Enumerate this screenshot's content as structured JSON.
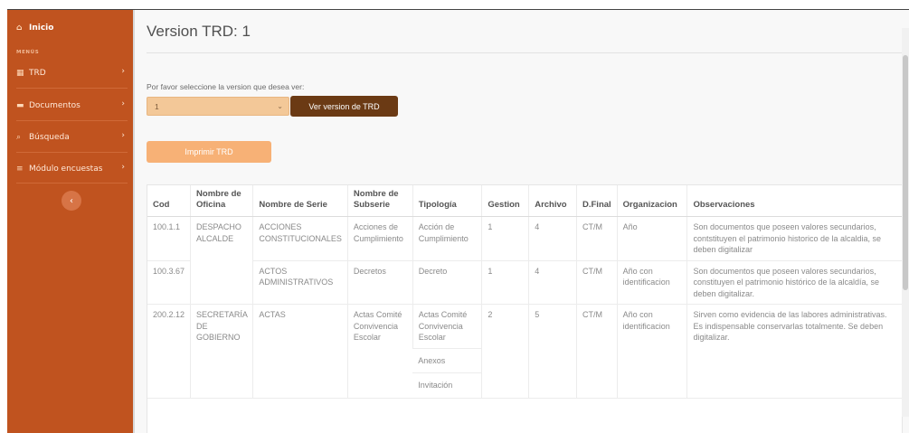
{
  "sidebar": {
    "home_label": "Inicio",
    "section_label": "MENÚS",
    "items": [
      {
        "label": "TRD",
        "icon": "table-icon"
      },
      {
        "label": "Documentos",
        "icon": "folder-icon"
      },
      {
        "label": "Búsqueda",
        "icon": "search-icon"
      },
      {
        "label": "Módulo encuestas",
        "icon": "list-icon"
      }
    ],
    "collapse_icon": "chevron-left-icon"
  },
  "main": {
    "title": "Version TRD: 1",
    "prompt": "Por favor seleccione la version que desea ver:",
    "select_value": "1",
    "ver_button": "Ver version de TRD",
    "print_button": "Imprimir TRD"
  },
  "table": {
    "headers": [
      "Cod",
      "Nombre de Oficina",
      "Nombre de Serie",
      "Nombre de Subserie",
      "Tipología",
      "Gestion",
      "Archivo",
      "D.Final",
      "Organizacion",
      "Observaciones"
    ],
    "rows": [
      {
        "cod": "100.1.1",
        "oficina": "DESPACHO ALCALDE",
        "serie": "ACCIONES CONSTITUCIONALES",
        "subserie": "Acciones de Cumplimiento",
        "tipologia": "Acción de Cumplimiento",
        "gestion": "1",
        "archivo": "4",
        "dfinal": "CT/M",
        "organizacion": "Año",
        "observaciones": "Son documentos que poseen valores secundarios, contstituyen el patrimonio historico de la alcaldia, se deben digitalizar"
      },
      {
        "cod": "100.3.67",
        "oficina": "",
        "serie": "ACTOS ADMINISTRATIVOS",
        "subserie": "Decretos",
        "tipologia": "Decreto",
        "gestion": "1",
        "archivo": "4",
        "dfinal": "CT/M",
        "organizacion": "Año con identificacion",
        "observaciones": "Son documentos que poseen valores secundarios, constituyen el patrimonio histórico de la alcaldía, se deben digitalizar."
      },
      {
        "cod": "200.2.12",
        "oficina": "SECRETARÍA DE GOBIERNO",
        "serie": "ACTAS",
        "subserie": "Actas Comité Convivencia Escolar",
        "tipologia": "Actas Comité Convivencia Escolar",
        "tipologia_extra": [
          "Anexos",
          "Invitación"
        ],
        "gestion": "2",
        "archivo": "5",
        "dfinal": "CT/M",
        "organizacion": "Año con identificacion",
        "observaciones": "Sirven como evidencia de las labores administrativas. Es indispensable conservarlas totalmente. Se deben digitalizar."
      }
    ]
  },
  "colors": {
    "sidebar_bg": "#c0531f",
    "ver_button_bg": "#6b3a14",
    "print_button_bg": "#f7b176",
    "select_bg": "#f3c898"
  }
}
